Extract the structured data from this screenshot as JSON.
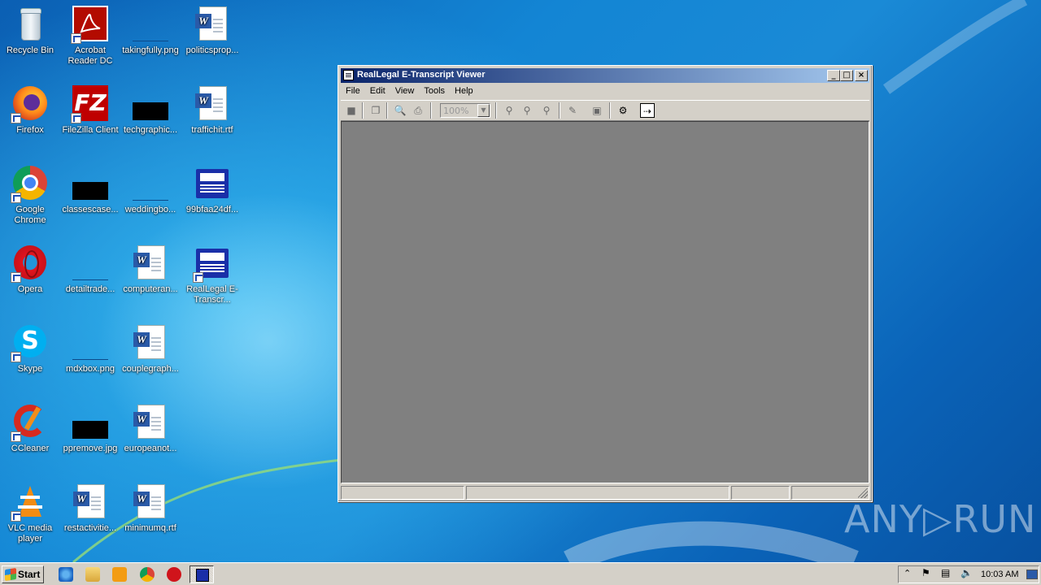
{
  "desktop": {
    "icons": [
      {
        "label": "Recycle Bin"
      },
      {
        "label": "Acrobat Reader DC"
      },
      {
        "label": "takingfully.png"
      },
      {
        "label": "politicsprop..."
      },
      {
        "label": "Firefox"
      },
      {
        "label": "FileZilla Client"
      },
      {
        "label": "techgraphic..."
      },
      {
        "label": "traffichit.rtf"
      },
      {
        "label": "Google Chrome"
      },
      {
        "label": "classescase..."
      },
      {
        "label": "weddingbo..."
      },
      {
        "label": "99bfaa24df..."
      },
      {
        "label": "Opera"
      },
      {
        "label": "detailtrade..."
      },
      {
        "label": "computeran..."
      },
      {
        "label": "RealLegal E-Transcr..."
      },
      {
        "label": "Skype"
      },
      {
        "label": "mdxbox.png"
      },
      {
        "label": "couplegraph..."
      },
      {
        "label": "CCleaner"
      },
      {
        "label": "ppremove.jpg"
      },
      {
        "label": "europeanot..."
      },
      {
        "label": "VLC media player"
      },
      {
        "label": "restactivitie..."
      },
      {
        "label": "minimumq.rtf"
      }
    ]
  },
  "window": {
    "title": "RealLegal E-Transcript Viewer",
    "menu": [
      "File",
      "Edit",
      "View",
      "Tools",
      "Help"
    ],
    "zoom": "100%",
    "controls": {
      "minimize": "_",
      "maximize": "□",
      "close": "×"
    }
  },
  "taskbar": {
    "start_label": "Start",
    "clock": "10:03 AM"
  },
  "watermark": "ANY▷RUN"
}
